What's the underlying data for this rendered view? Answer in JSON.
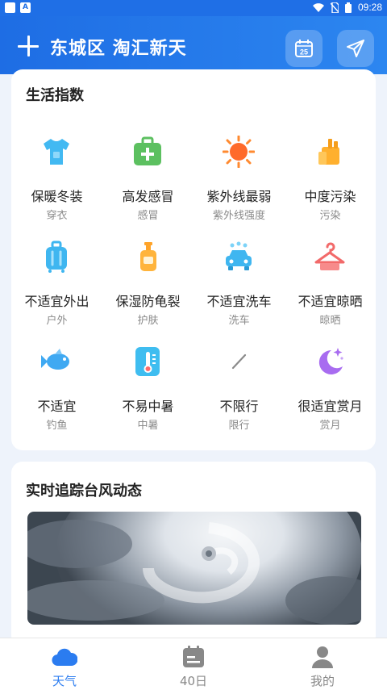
{
  "status_bar": {
    "time": "09:28"
  },
  "header": {
    "location": "东城区 淘汇新天"
  },
  "life_index": {
    "title": "生活指数",
    "items": [
      {
        "main": "保暖冬装",
        "sub": "穿衣",
        "icon": "tshirt-icon"
      },
      {
        "main": "高发感冒",
        "sub": "感冒",
        "icon": "medkit-icon"
      },
      {
        "main": "紫外线最弱",
        "sub": "紫外线强度",
        "icon": "sun-icon"
      },
      {
        "main": "中度污染",
        "sub": "污染",
        "icon": "factory-icon"
      },
      {
        "main": "不适宜外出",
        "sub": "户外",
        "icon": "luggage-icon"
      },
      {
        "main": "保湿防龟裂",
        "sub": "护肤",
        "icon": "lotion-bottle-icon"
      },
      {
        "main": "不适宜洗车",
        "sub": "洗车",
        "icon": "car-wash-icon"
      },
      {
        "main": "不适宜晾晒",
        "sub": "晾晒",
        "icon": "hanger-icon"
      },
      {
        "main": "不适宜",
        "sub": "钓鱼",
        "icon": "fish-icon"
      },
      {
        "main": "不易中暑",
        "sub": "中暑",
        "icon": "thermometer-icon"
      },
      {
        "main": "不限行",
        "sub": "限行",
        "icon": "slash-icon"
      },
      {
        "main": "很适宜赏月",
        "sub": "赏月",
        "icon": "moon-icon"
      }
    ]
  },
  "typhoon": {
    "title": "实时追踪台风动态"
  },
  "bottom_nav": [
    {
      "label": "天气",
      "icon": "cloud-icon",
      "active": true
    },
    {
      "label": "40日",
      "icon": "calendar-icon",
      "active": false
    },
    {
      "label": "我的",
      "icon": "user-icon",
      "active": false
    }
  ],
  "colors": {
    "primary": "#1f6fe6",
    "active_nav": "#2b7cf0"
  }
}
